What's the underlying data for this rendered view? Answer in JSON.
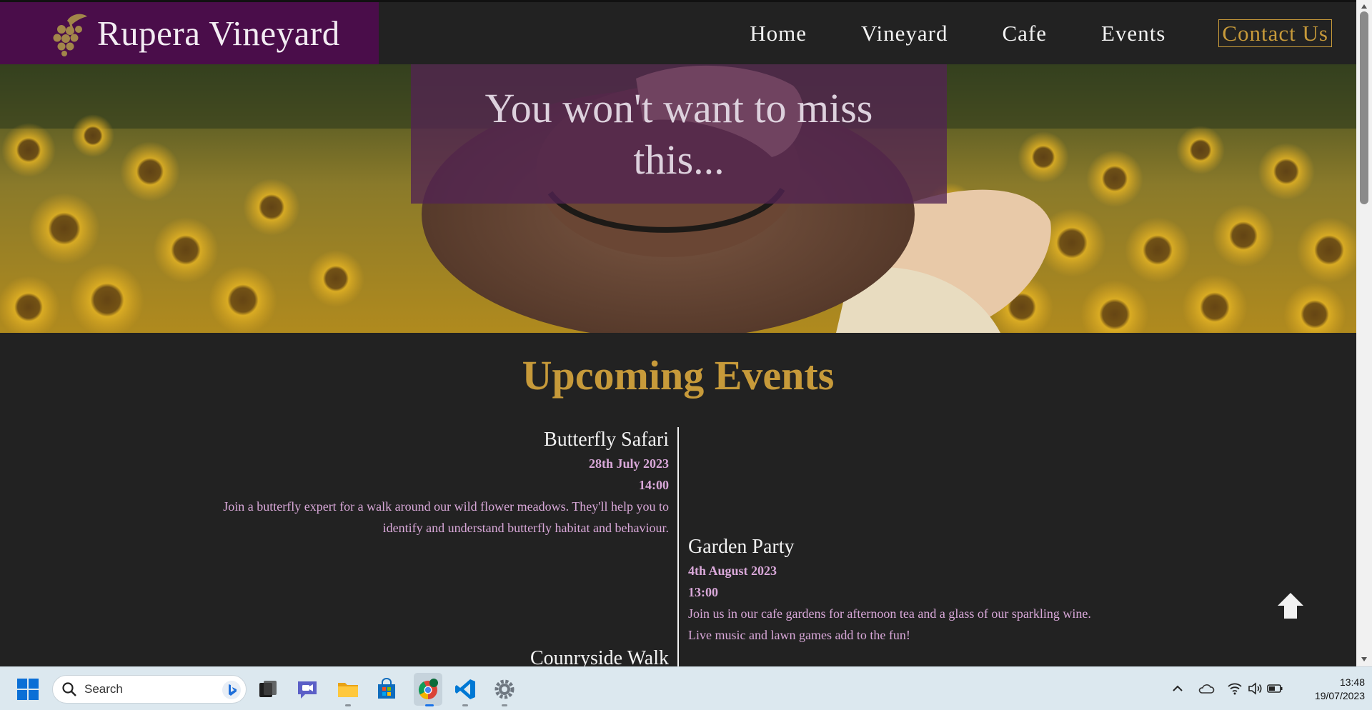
{
  "header": {
    "brand": "Rupera Vineyard",
    "nav": [
      "Home",
      "Vineyard",
      "Cafe",
      "Events",
      "Contact Us"
    ]
  },
  "hero": {
    "title": "You won't want to miss this..."
  },
  "events": {
    "title": "Upcoming Events",
    "items": [
      {
        "name": "Butterfly Safari",
        "date": "28th July 2023",
        "time": "14:00",
        "description": "Join a butterfly expert for a walk around our wild flower meadows. They'll help you to identify and understand butterfly habitat and behaviour."
      },
      {
        "name": "Garden Party",
        "date": "4th August 2023",
        "time": "13:00",
        "description": "Join us in our cafe gardens for afternoon tea and a glass of our sparkling wine. Live music and lawn games add to the fun!"
      },
      {
        "name": "Counryside Walk"
      }
    ]
  },
  "taskbar": {
    "search_placeholder": "Search",
    "time": "13:48",
    "date": "19/07/2023",
    "icons": [
      "windows-start-icon",
      "search-icon",
      "bing-icon",
      "task-view-icon",
      "teams-chat-icon",
      "file-explorer-icon",
      "microsoft-store-icon",
      "chrome-icon",
      "vscode-icon",
      "settings-icon",
      "chevron-up-icon",
      "onedrive-icon",
      "wifi-icon",
      "speaker-icon",
      "battery-icon"
    ]
  },
  "colors": {
    "brand_purple": "#4a0d4a",
    "accent_gold": "#c79a3a",
    "page_bg": "#222222",
    "event_text": "#d9a8d9"
  }
}
